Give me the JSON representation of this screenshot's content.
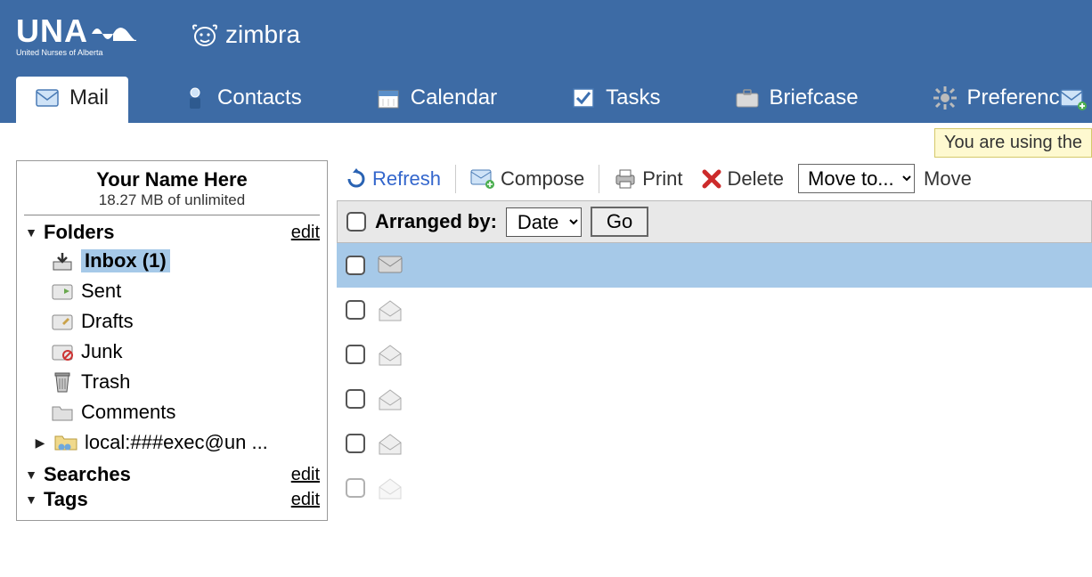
{
  "logo": {
    "text": "UNA",
    "subtext": "United Nurses of Alberta"
  },
  "app": {
    "name": "zimbra"
  },
  "nav": {
    "mail": "Mail",
    "contacts": "Contacts",
    "calendar": "Calendar",
    "tasks": "Tasks",
    "briefcase": "Briefcase",
    "preferences": "Preferences"
  },
  "banner": "You are using the",
  "user": {
    "name": "Your Name Here",
    "quota": "18.27 MB of unlimited"
  },
  "sidebar": {
    "folders_label": "Folders",
    "edit": "edit",
    "items": {
      "inbox": "Inbox (1)",
      "sent": "Sent",
      "drafts": "Drafts",
      "junk": "Junk",
      "trash": "Trash",
      "comments": "Comments",
      "shared": "local:###exec@un ..."
    },
    "searches_label": "Searches",
    "tags_label": "Tags"
  },
  "toolbar": {
    "refresh": "Refresh",
    "compose": "Compose",
    "print": "Print",
    "delete": "Delete",
    "move_placeholder": "Move to...",
    "move_action": "Move"
  },
  "listhead": {
    "arranged": "Arranged by:",
    "sort": "Date",
    "go": "Go"
  }
}
